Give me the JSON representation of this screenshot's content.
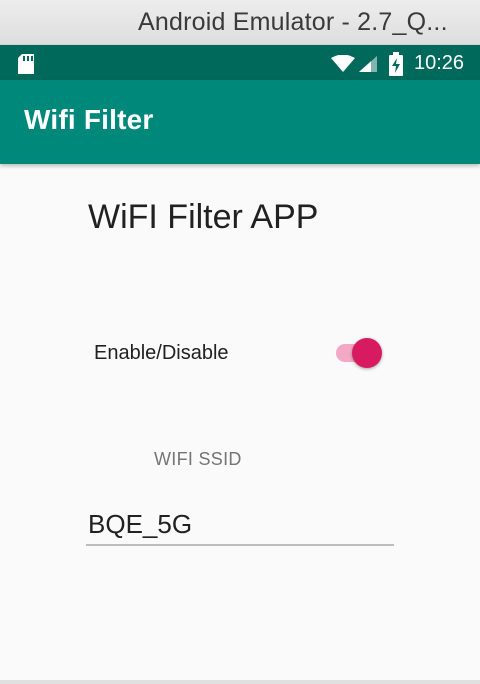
{
  "window": {
    "title": "Android Emulator - 2.7_Q..."
  },
  "status_bar": {
    "time": "10:26",
    "background_color": "#00695c",
    "icons": [
      "sd-card-icon",
      "wifi-icon",
      "cell-signal-icon",
      "battery-charging-icon"
    ]
  },
  "app_bar": {
    "title": "Wifi Filter",
    "background_color": "#00897b"
  },
  "main": {
    "heading": "WiFI Filter APP",
    "toggle": {
      "label": "Enable/Disable",
      "state": "on",
      "accent_color": "#d81b60"
    },
    "ssid": {
      "label": "WIFI SSID",
      "value": "BQE_5G"
    }
  }
}
